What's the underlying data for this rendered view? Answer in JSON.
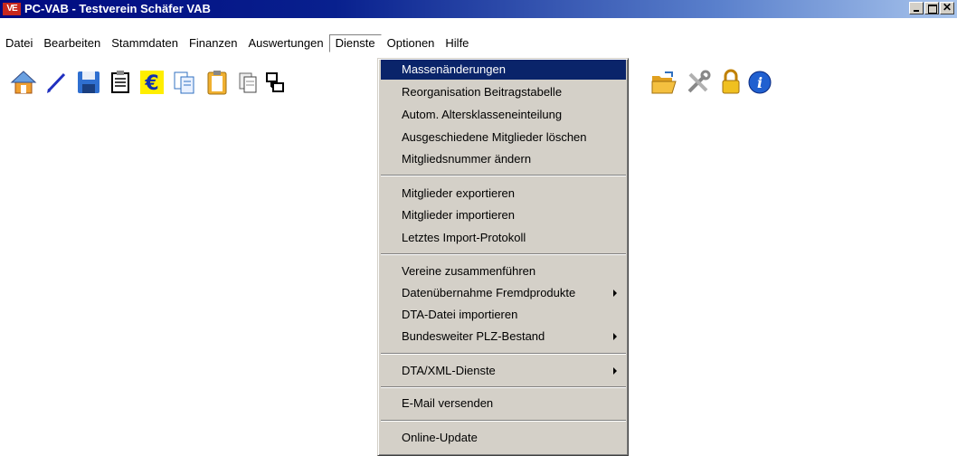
{
  "window": {
    "app_icon_text": "VE",
    "title": "PC-VAB  -  Testverein Schäfer VAB"
  },
  "menubar": {
    "items": [
      {
        "label": "Datei"
      },
      {
        "label": "Bearbeiten"
      },
      {
        "label": "Stammdaten"
      },
      {
        "label": "Finanzen"
      },
      {
        "label": "Auswertungen"
      },
      {
        "label": "Dienste"
      },
      {
        "label": "Optionen"
      },
      {
        "label": "Hilfe"
      }
    ],
    "open_menu": "Dienste"
  },
  "toolbar": {
    "icons": [
      "home-icon",
      "pen-icon",
      "save-icon",
      "notepad-icon",
      "euro-icon",
      "copy-icon",
      "clipboard-icon",
      "documents-icon",
      "hierarchy-icon",
      "folder-open-icon",
      "tools-icon",
      "lock-icon",
      "info-icon"
    ]
  },
  "dienste_menu": {
    "items": [
      {
        "label": "Massenänderungen",
        "highlighted": true
      },
      {
        "label": "Reorganisation Beitragstabelle"
      },
      {
        "label": "Autom. Altersklasseneinteilung"
      },
      {
        "label": "Ausgeschiedene Mitglieder löschen"
      },
      {
        "label": "Mitgliedsnummer ändern"
      },
      {
        "label": "Mitglieder exportieren"
      },
      {
        "label": "Mitglieder importieren"
      },
      {
        "label": "Letztes Import-Protokoll"
      },
      {
        "label": "Vereine zusammenführen"
      },
      {
        "label": "Datenübernahme Fremdprodukte",
        "submenu": true
      },
      {
        "label": "DTA-Datei importieren"
      },
      {
        "label": "Bundesweiter PLZ-Bestand",
        "submenu": true
      },
      {
        "label": "DTA/XML-Dienste",
        "submenu": true
      },
      {
        "label": "E-Mail versenden"
      },
      {
        "label": "Online-Update"
      }
    ]
  },
  "colors": {
    "titlebar_start": "#000a80",
    "titlebar_end": "#a8c4ec",
    "menu_highlight": "#0a246a",
    "menu_bg": "#d4d0c8"
  }
}
